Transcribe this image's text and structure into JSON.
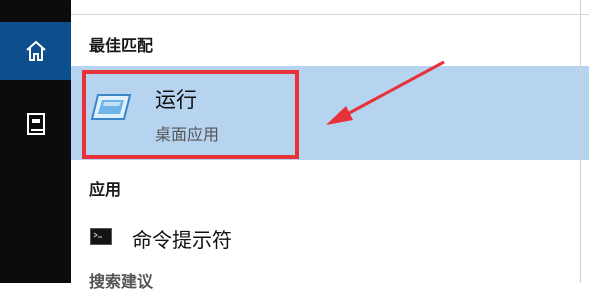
{
  "sidebar": {
    "icons": [
      "home-icon",
      "book-icon"
    ]
  },
  "sections": {
    "best_match": "最佳匹配",
    "apps": "应用",
    "search_suggestions": "搜索建议"
  },
  "best_result": {
    "title": "运行",
    "subtitle": "桌面应用",
    "icon": "run-dialog-icon"
  },
  "app_results": [
    {
      "label": "命令提示符",
      "icon": "cmd-icon"
    }
  ],
  "colors": {
    "rail": "#0c0c0c",
    "active_rail": "#0d4f8c",
    "highlight": "#b6d3ef",
    "annotation": "#e8323a"
  }
}
